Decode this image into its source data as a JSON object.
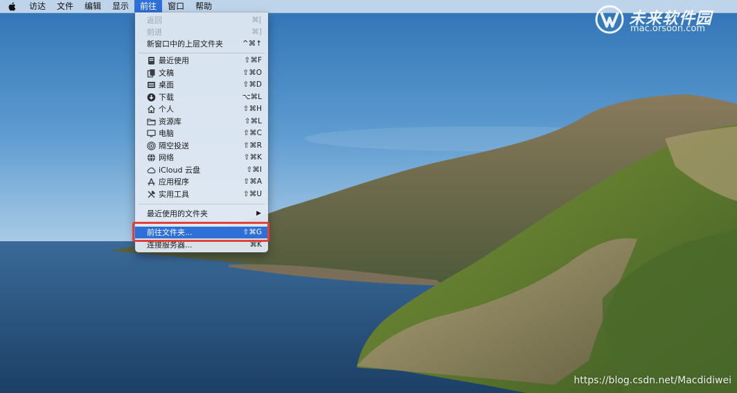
{
  "menubar": {
    "apple_icon": "apple-logo-icon",
    "items": [
      "访达",
      "文件",
      "编辑",
      "显示",
      "前往",
      "窗口",
      "帮助"
    ],
    "active": "前往"
  },
  "go_menu": {
    "back": {
      "label": "返回",
      "shortcut": "⌘["
    },
    "forward": {
      "label": "前进",
      "shortcut": "⌘]"
    },
    "enclosing_folder_new_window": {
      "label": "新窗口中的上层文件夹",
      "shortcut": "^⌘↑"
    },
    "locations": [
      {
        "label": "最近使用",
        "shortcut": "⇧⌘F",
        "icon": "recents-icon"
      },
      {
        "label": "文稿",
        "shortcut": "⇧⌘O",
        "icon": "documents-icon"
      },
      {
        "label": "桌面",
        "shortcut": "⇧⌘D",
        "icon": "desktop-icon"
      },
      {
        "label": "下载",
        "shortcut": "⌥⌘L",
        "icon": "downloads-icon"
      },
      {
        "label": "个人",
        "shortcut": "⇧⌘H",
        "icon": "home-icon"
      },
      {
        "label": "资源库",
        "shortcut": "⇧⌘L",
        "icon": "folder-icon"
      },
      {
        "label": "电脑",
        "shortcut": "⇧⌘C",
        "icon": "computer-icon"
      },
      {
        "label": "隔空投送",
        "shortcut": "⇧⌘R",
        "icon": "airdrop-icon"
      },
      {
        "label": "网络",
        "shortcut": "⇧⌘K",
        "icon": "network-icon"
      },
      {
        "label": "iCloud 云盘",
        "shortcut": "⇧⌘I",
        "icon": "icloud-icon"
      },
      {
        "label": "应用程序",
        "shortcut": "⇧⌘A",
        "icon": "applications-icon"
      },
      {
        "label": "实用工具",
        "shortcut": "⇧⌘U",
        "icon": "utilities-icon"
      }
    ],
    "recent_folders": {
      "label": "最近使用的文件夹",
      "submenu_indicator": "▶"
    },
    "go_to_folder": {
      "label": "前往文件夹...",
      "shortcut": "⇧⌘G"
    },
    "connect_to_server": {
      "label": "连接服务器...",
      "shortcut": "⌘K"
    }
  },
  "watermark": {
    "brand": "未来软件园",
    "url": "mac.orsoon.com"
  },
  "credit": "https://blog.csdn.net/Macdidiwei",
  "colors": {
    "highlight": "#2e6fd8",
    "annotation_box": "#e0413a"
  }
}
